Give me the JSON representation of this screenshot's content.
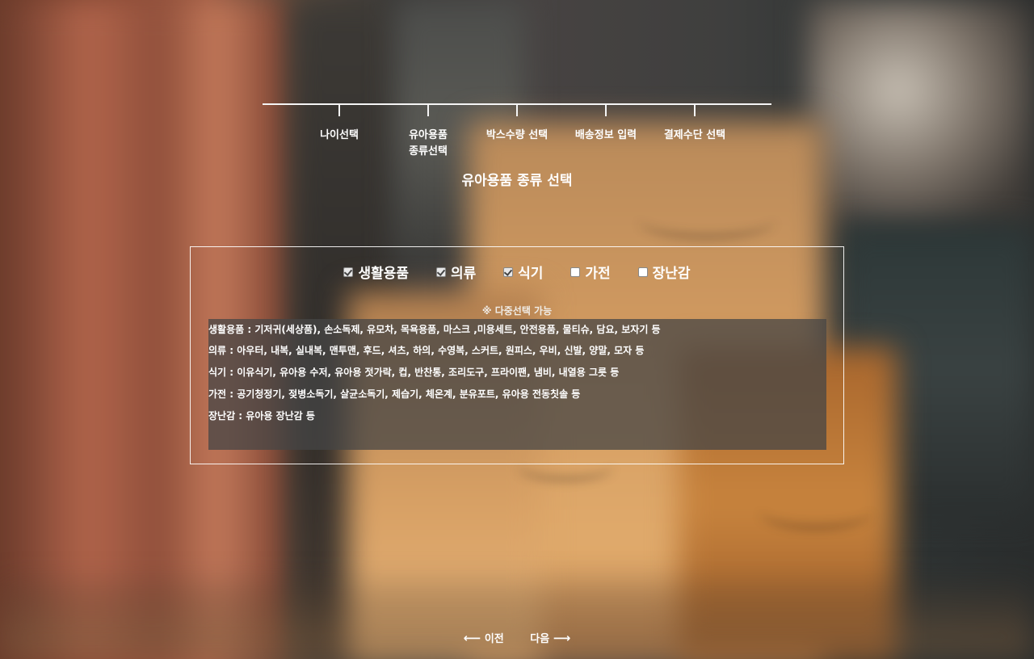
{
  "steps": [
    {
      "label": "나이선택"
    },
    {
      "label": "유아용품\n종류선택"
    },
    {
      "label": "박스수량 선택"
    },
    {
      "label": "배송정보 입력"
    },
    {
      "label": "결제수단 선택"
    }
  ],
  "page_title": "유아용품 종류 선택",
  "options": [
    {
      "label": "생활용품",
      "checked": true
    },
    {
      "label": "의류",
      "checked": true
    },
    {
      "label": "식기",
      "checked": true
    },
    {
      "label": "가전",
      "checked": false
    },
    {
      "label": "장난감",
      "checked": false
    }
  ],
  "multi_select_note": "※ 다중선택 가능",
  "descriptions": [
    "생활용품 : 기저귀(세상품), 손소독제, 유모차, 목욕용품, 마스크 ,미용세트, 안전용품, 물티슈, 담요, 보자기 등",
    "의류 : 아우터, 내복, 실내복, 맨투맨, 후드, 셔츠, 하의, 수영복, 스커트, 원피스, 우비, 신발, 양말, 모자 등",
    "식기 : 이유식기, 유아용 수저, 유아용 젓가락, 컵, 반찬통, 조리도구, 프라이팬, 냄비, 내열용 그릇 등",
    "가전 : 공기청정기, 젖병소독기, 살균소독기, 제습기, 체온계, 분유포트, 유아용 전동칫솔 등",
    "장난감 : 유아용 장난감 등"
  ],
  "nav": {
    "prev_arrow": "⟵",
    "prev_label": "이전",
    "next_label": "다음",
    "next_arrow": "⟶"
  }
}
